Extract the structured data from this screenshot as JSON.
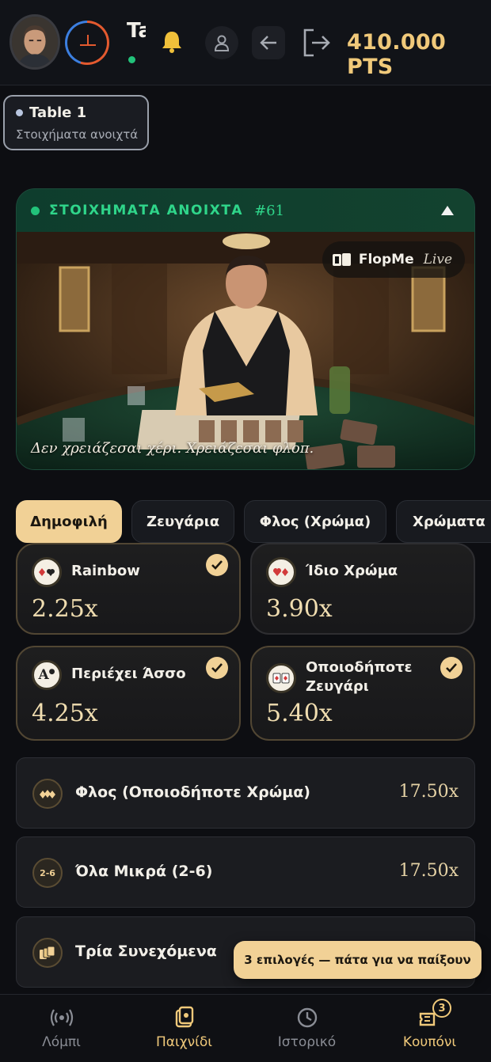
{
  "header": {
    "title_truncated": "Ta",
    "points": "410.000 PTS",
    "icons": [
      "avatar",
      "round-timer-icon",
      "bell-icon",
      "profile-icon",
      "back-arrow-icon",
      "exit-icon"
    ]
  },
  "table": {
    "name": "Table 1",
    "status": "Στοιχήματα ανοιχτά"
  },
  "hero": {
    "status": "ΣΤΟΙΧΗΜΑΤΑ ΑΝΟΙΧΤΑ",
    "round": "#61",
    "brand": "FlopMe",
    "brand_suffix": "Live",
    "tagline": "Δεν χρειάζεσαι χέρι. Χρειάζεσαι φλοπ."
  },
  "tabs": [
    {
      "label": "Δημοφιλή",
      "active": true
    },
    {
      "label": "Ζευγάρια",
      "active": false
    },
    {
      "label": "Φλος (Χρώμα)",
      "active": false
    },
    {
      "label": "Χρώματα",
      "active": false
    }
  ],
  "grid_bets": [
    {
      "label": "Rainbow",
      "odds": "2.25x",
      "selected": true,
      "icon": "suits-icon"
    },
    {
      "label": "Ίδιο Χρώμα",
      "odds": "3.90x",
      "selected": false,
      "icon": "hearts-icon"
    },
    {
      "label": "Περιέχει Άσσο",
      "odds": "4.25x",
      "selected": true,
      "icon": "ace-icon"
    },
    {
      "label_line1": "Οποιοδήποτε",
      "label_line2": "Ζευγάρι",
      "odds": "5.40x",
      "selected": true,
      "icon": "pair-cards-icon"
    }
  ],
  "list_bets": [
    {
      "label": "Φλος (Οποιοδήποτε Χρώμα)",
      "odds": "17.50x",
      "icon": "flush-icon"
    },
    {
      "label": "Όλα Μικρά (2-6)",
      "odds": "17.50x",
      "icon_text": "2-6"
    },
    {
      "label": "Τρία Συνεχόμενα",
      "odds": "",
      "icon": "straight-cards-icon"
    }
  ],
  "toast": "3 επιλογές — πάτα για να παίξουν",
  "nav": [
    {
      "label": "Λόμπι",
      "icon": "broadcast-icon",
      "active": false
    },
    {
      "label": "Παιχνίδι",
      "icon": "game-icon",
      "active": true
    },
    {
      "label": "Ιστορικό",
      "icon": "history-icon",
      "active": false
    },
    {
      "label": "Κουπόνι",
      "icon": "coupon-icon",
      "active": true,
      "badge": "3"
    }
  ],
  "colors": {
    "accent": "#f0c97a",
    "live_green": "#2fd58a",
    "card_border_selected": "#514633"
  }
}
